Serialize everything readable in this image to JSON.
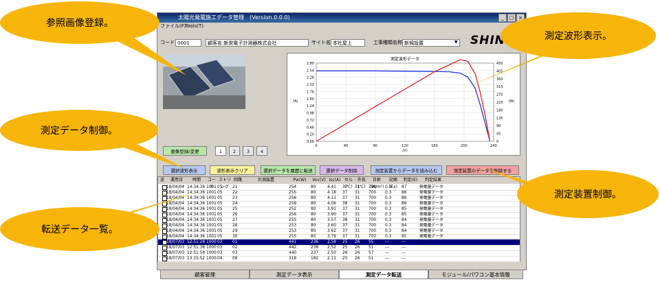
{
  "window": {
    "title": "太陽光発電施工データ管理　(Version.0.0.0)",
    "menu": [
      "ファイル(F)",
      "Tools(T)"
    ]
  },
  "fields": {
    "code_label": "コード",
    "code_value": "0001",
    "customer_value": "顧客名:新栄電子計測器株式会社",
    "site_label": "サイト名称",
    "site_value": "本社屋上",
    "work_label": "工事種類名称",
    "work_value": "新規設置"
  },
  "logo": "SHIN",
  "image_panel": {
    "register_button": "画像登録/変更",
    "pages": [
      "1",
      "2",
      "3",
      "4"
    ]
  },
  "chart_data": {
    "type": "line",
    "title": "測定波形データ",
    "xlabel": "(V)",
    "ylabel_left": "(A)",
    "ylabel_right": "(W)",
    "xlim": [
      0,
      240
    ],
    "ylim_left": [
      0,
      2.8
    ],
    "ylim_right": [
      0,
      450
    ],
    "x_ticks": [
      "0",
      "40",
      "80",
      "120",
      "160",
      "200",
      "240"
    ],
    "y_ticks_left": [
      "2.80",
      "2.54",
      "2.28",
      "2.02",
      "1.76",
      "1.50",
      "1.24",
      "0.98",
      "0.72",
      "0.46",
      "0.20",
      "0.00"
    ],
    "y_ticks_right": [
      "450",
      "405",
      "360",
      "315",
      "270",
      "225",
      "180",
      "135",
      "90",
      "45",
      "0"
    ],
    "series": [
      {
        "color": "#2030e0",
        "x": [
          0,
          40,
          80,
          120,
          160,
          180,
          195,
          205,
          215,
          222,
          228,
          232,
          235
        ],
        "y": [
          2.52,
          2.52,
          2.52,
          2.51,
          2.5,
          2.49,
          2.44,
          2.3,
          1.9,
          1.3,
          0.7,
          0.3,
          0
        ]
      },
      {
        "color": "#e02020",
        "x": [
          0,
          40,
          80,
          120,
          160,
          180,
          195,
          205,
          215,
          222,
          228,
          232,
          235
        ],
        "y": [
          0,
          100,
          200,
          300,
          400,
          440,
          470,
          460,
          390,
          280,
          160,
          70,
          0
        ]
      }
    ]
  },
  "buttons": {
    "show_selected": "選択波形表示",
    "clear_waveform": "波形表示クリア",
    "transfer_history": "選択データを履歴に転送",
    "delete_selected": "選択データ削除",
    "read_device": "測定装置からデータを読み込む",
    "delete_device": "測定装置のデータを削除する"
  },
  "table": {
    "headers": [
      "送",
      "運用日",
      "時間",
      "コード",
      "ストリング",
      "回路",
      "計測装置",
      "Pw(W)",
      "Voc(V)",
      "Isc(A)",
      "セル(℃)",
      "外気(℃)",
      "日射(W/m²)",
      "記帳(Ex)",
      "判定(E)",
      "判定結果"
    ],
    "rows": [
      [
        "",
        "18/04/04",
        "14:34:36",
        "1001",
        "05",
        "21",
        "",
        "254",
        "80",
        "4.41",
        "37",
        "31",
        "700",
        "0.3",
        "87",
        "発電量データ"
      ],
      [
        "",
        "18/04/04",
        "14:34:36",
        "1001",
        "05",
        "22",
        "",
        "255",
        "80",
        "4.18",
        "37",
        "31",
        "700",
        "0.3",
        "86",
        "発電量データ"
      ],
      [
        "",
        "18/04/04",
        "14:34:36",
        "1001",
        "05",
        "23",
        "",
        "256",
        "80",
        "4.11",
        "37",
        "31",
        "700",
        "0.3",
        "86",
        "発電量データ"
      ],
      [
        "",
        "18/04/04",
        "14:34:36",
        "1001",
        "05",
        "24",
        "",
        "259",
        "80",
        "4.06",
        "38",
        "31",
        "700",
        "0.3",
        "86",
        "発電量データ"
      ],
      [
        "",
        "18/04/04",
        "14:34:36",
        "1001",
        "05",
        "25",
        "",
        "252",
        "80",
        "3.91",
        "37",
        "31",
        "700",
        "0.3",
        "85",
        "発電量データ"
      ],
      [
        "",
        "18/04/04",
        "14:34:36",
        "1001",
        "05",
        "26",
        "",
        "256",
        "80",
        "3.90",
        "37",
        "31",
        "700",
        "0.3",
        "85",
        "発電量データ"
      ],
      [
        "",
        "18/04/04",
        "14:34:36",
        "1001",
        "05",
        "27",
        "",
        "255",
        "80",
        "3.57",
        "38",
        "31",
        "700",
        "0.3",
        "84",
        "発電量データ"
      ],
      [
        "",
        "18/04/04",
        "14:34:36",
        "1001",
        "05",
        "28",
        "",
        "253",
        "80",
        "3.60",
        "37",
        "31",
        "700",
        "0.3",
        "84",
        "発電量データ"
      ],
      [
        "",
        "18/04/04",
        "14:34:36",
        "1001",
        "05",
        "29",
        "",
        "253",
        "80",
        "3.62",
        "37",
        "31",
        "700",
        "0.3",
        "84",
        "発電量データ"
      ],
      [
        "",
        "18/04/04",
        "14:34:36",
        "1001",
        "05",
        "30",
        "",
        "255",
        "80",
        "3.79",
        "37",
        "31",
        "700",
        "0.3",
        "85",
        "発電量データ"
      ],
      [
        "",
        "18/07/03",
        "12:51:28",
        "1000",
        "03",
        "01",
        "",
        "441",
        "236",
        "2.58",
        "25",
        "26",
        "55",
        "---",
        "---",
        ""
      ],
      [
        "",
        "18/07/03",
        "12:51:38",
        "1000",
        "03",
        "02",
        "",
        "442",
        "238",
        "2.52",
        "25",
        "26",
        "51",
        "---",
        "---",
        ""
      ],
      [
        "",
        "18/07/03",
        "12:51:58",
        "1000",
        "03",
        "03",
        "",
        "440",
        "237",
        "2.50",
        "26",
        "26",
        "57",
        "---",
        "---",
        ""
      ],
      [
        "",
        "18/07/03",
        "13:15:52",
        "1000",
        "04",
        "08",
        "",
        "318",
        "182",
        "2.11",
        "25",
        "26",
        "51",
        "---",
        "---",
        ""
      ]
    ]
  },
  "tabs": [
    "顧客管理",
    "測定データ表示",
    "測定データ転送",
    "モジュール/パワコン基本情報"
  ],
  "callouts": {
    "image_register": "参照画像登録。",
    "waveform_display": "測定波形表示。",
    "data_control": "測定データ制御。",
    "device_control": "測定装置制御。",
    "transfer_list": "転送データ一覧。"
  },
  "colors": {
    "bubble": "#f7b50a",
    "selected_row": "#00007a",
    "btn_green": "#b6e6a8",
    "btn_blue": "#b4c8f0",
    "btn_yellow": "#f6f29a",
    "btn_purple": "#d8b8e8",
    "btn_red": "#f0a0a0"
  }
}
